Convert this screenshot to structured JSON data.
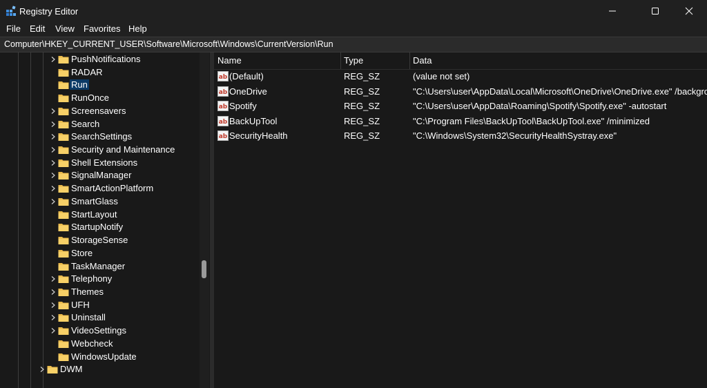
{
  "window": {
    "title": "Registry Editor",
    "accent": "#0b3a66"
  },
  "menu": [
    "File",
    "Edit",
    "View",
    "Favorites",
    "Help"
  ],
  "address": "Computer\\HKEY_CURRENT_USER\\Software\\Microsoft\\Windows\\CurrentVersion\\Run",
  "tree": [
    {
      "label": "PushNotifications",
      "expandable": true
    },
    {
      "label": "RADAR",
      "expandable": false
    },
    {
      "label": "Run",
      "expandable": false,
      "selected": true
    },
    {
      "label": "RunOnce",
      "expandable": false
    },
    {
      "label": "Screensavers",
      "expandable": true
    },
    {
      "label": "Search",
      "expandable": true
    },
    {
      "label": "SearchSettings",
      "expandable": true
    },
    {
      "label": "Security and Maintenance",
      "expandable": true
    },
    {
      "label": "Shell Extensions",
      "expandable": true
    },
    {
      "label": "SignalManager",
      "expandable": true
    },
    {
      "label": "SmartActionPlatform",
      "expandable": true
    },
    {
      "label": "SmartGlass",
      "expandable": true
    },
    {
      "label": "StartLayout",
      "expandable": false
    },
    {
      "label": "StartupNotify",
      "expandable": false
    },
    {
      "label": "StorageSense",
      "expandable": false
    },
    {
      "label": "Store",
      "expandable": false
    },
    {
      "label": "TaskManager",
      "expandable": false
    },
    {
      "label": "Telephony",
      "expandable": true
    },
    {
      "label": "Themes",
      "expandable": true
    },
    {
      "label": "UFH",
      "expandable": true
    },
    {
      "label": "Uninstall",
      "expandable": true
    },
    {
      "label": "VideoSettings",
      "expandable": true
    },
    {
      "label": "Webcheck",
      "expandable": false
    },
    {
      "label": "WindowsUpdate",
      "expandable": false
    },
    {
      "label": "DWM",
      "expandable": true,
      "parent_level": true
    }
  ],
  "columns": {
    "name": "Name",
    "type": "Type",
    "data": "Data"
  },
  "values": [
    {
      "name": "(Default)",
      "type": "REG_SZ",
      "data": "(value not set)"
    },
    {
      "name": "OneDrive",
      "type": "REG_SZ",
      "data": "\"C:\\Users\\user\\AppData\\Local\\Microsoft\\OneDrive\\OneDrive.exe\" /background"
    },
    {
      "name": "Spotify",
      "type": "REG_SZ",
      "data": "\"C:\\Users\\user\\AppData\\Roaming\\Spotify\\Spotify.exe\" -autostart"
    },
    {
      "name": "BackUpTool",
      "type": "REG_SZ",
      "data": "\"C:\\Program Files\\BackUpTool\\BackUpTool.exe\" /minimized"
    },
    {
      "name": "SecurityHealth",
      "type": "REG_SZ",
      "data": "\"C:\\Windows\\System32\\SecurityHealthSystray.exe\""
    }
  ],
  "icons": {
    "app": "registry-icon",
    "folder": "folder-icon",
    "string_value": "string-value-icon",
    "chevron": "chevron-right-icon"
  }
}
